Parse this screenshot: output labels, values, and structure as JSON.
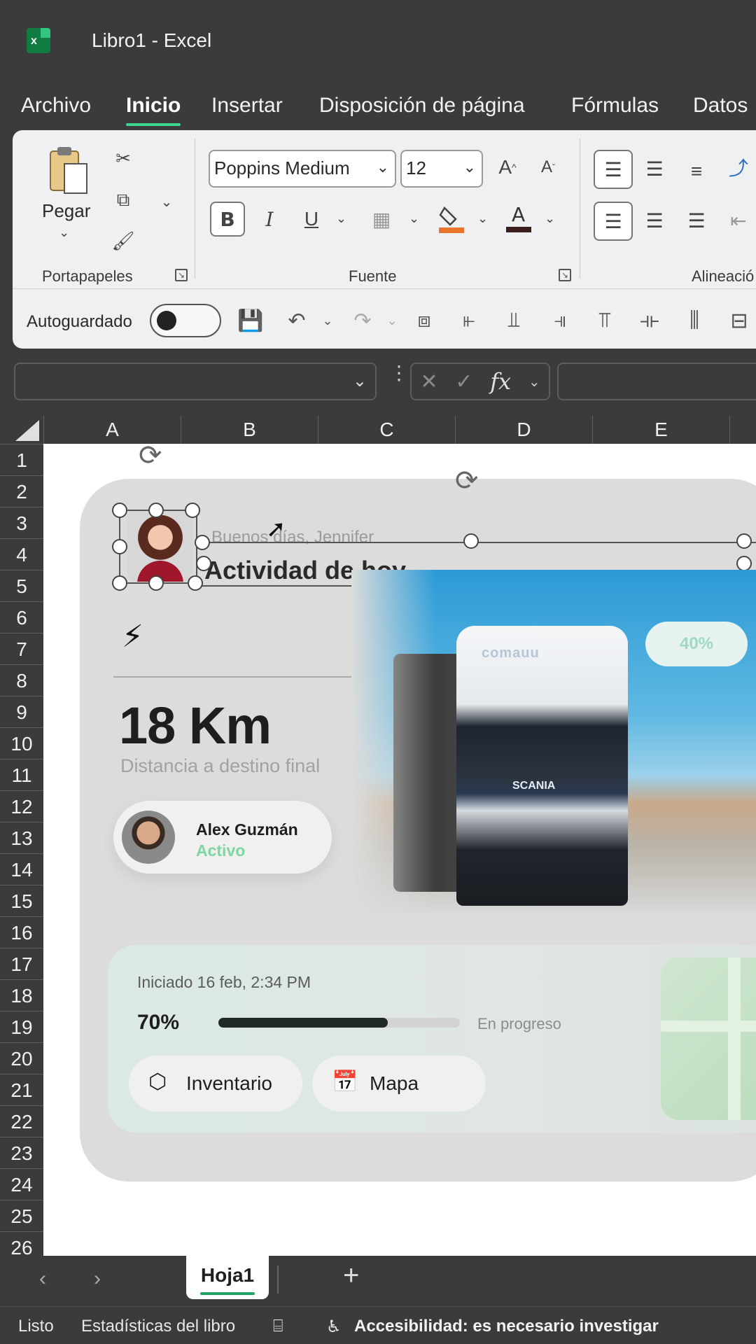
{
  "window": {
    "title": "Libro1  -  Excel",
    "app_icon": "excel-icon"
  },
  "menu": {
    "items": [
      "Archivo",
      "Inicio",
      "Insertar",
      "Disposición de página",
      "Fórmulas",
      "Datos"
    ],
    "active": "Inicio"
  },
  "ribbon": {
    "paste_label": "Pegar",
    "groups": {
      "clipboard": "Portapapeles",
      "font": "Fuente",
      "alignment": "Alineació"
    },
    "font_name": "Poppins Medium",
    "font_size": "12",
    "font_buttons": {
      "bold": "B",
      "italic": "I",
      "underline": "U",
      "font_color": "A"
    },
    "autosave_label": "Autoguardado",
    "autosave_on": false,
    "fill_color": "#e8752c",
    "font_color": "#3a1d1d"
  },
  "formula_bar": {
    "name_box": "",
    "formula": "",
    "fx": "fx"
  },
  "columns": [
    "A",
    "B",
    "C",
    "D",
    "E"
  ],
  "rows": [
    "1",
    "2",
    "3",
    "4",
    "5",
    "6",
    "7",
    "8",
    "9",
    "10",
    "11",
    "12",
    "13",
    "14",
    "15",
    "16",
    "17",
    "18",
    "19",
    "20",
    "21",
    "22",
    "23",
    "24",
    "25",
    "26"
  ],
  "dashboard": {
    "greeting": "Buenos días, Jennifer",
    "title": "Actividad de hoy",
    "distance": "18 Km",
    "distance_label": "Distancia a destino final",
    "driver_name": "Alex Guzmán",
    "driver_status": "Activo",
    "badge": "40%",
    "truck_brand": "SCANIA",
    "truck_label": "comauu",
    "started": "Iniciado 16 feb, 2:34 PM",
    "progress_text": "70%",
    "progress_value": 0.7,
    "progress_status": "En progreso",
    "btn_inventory": "Inventario",
    "btn_map": "Mapa",
    "accent": "#7ed6a4"
  },
  "sheet_tabs": {
    "active": "Hoja1",
    "add": "+"
  },
  "status": {
    "ready": "Listo",
    "stats": "Estadísticas del libro",
    "accessibility": "Accesibilidad: es necesario investigar"
  }
}
